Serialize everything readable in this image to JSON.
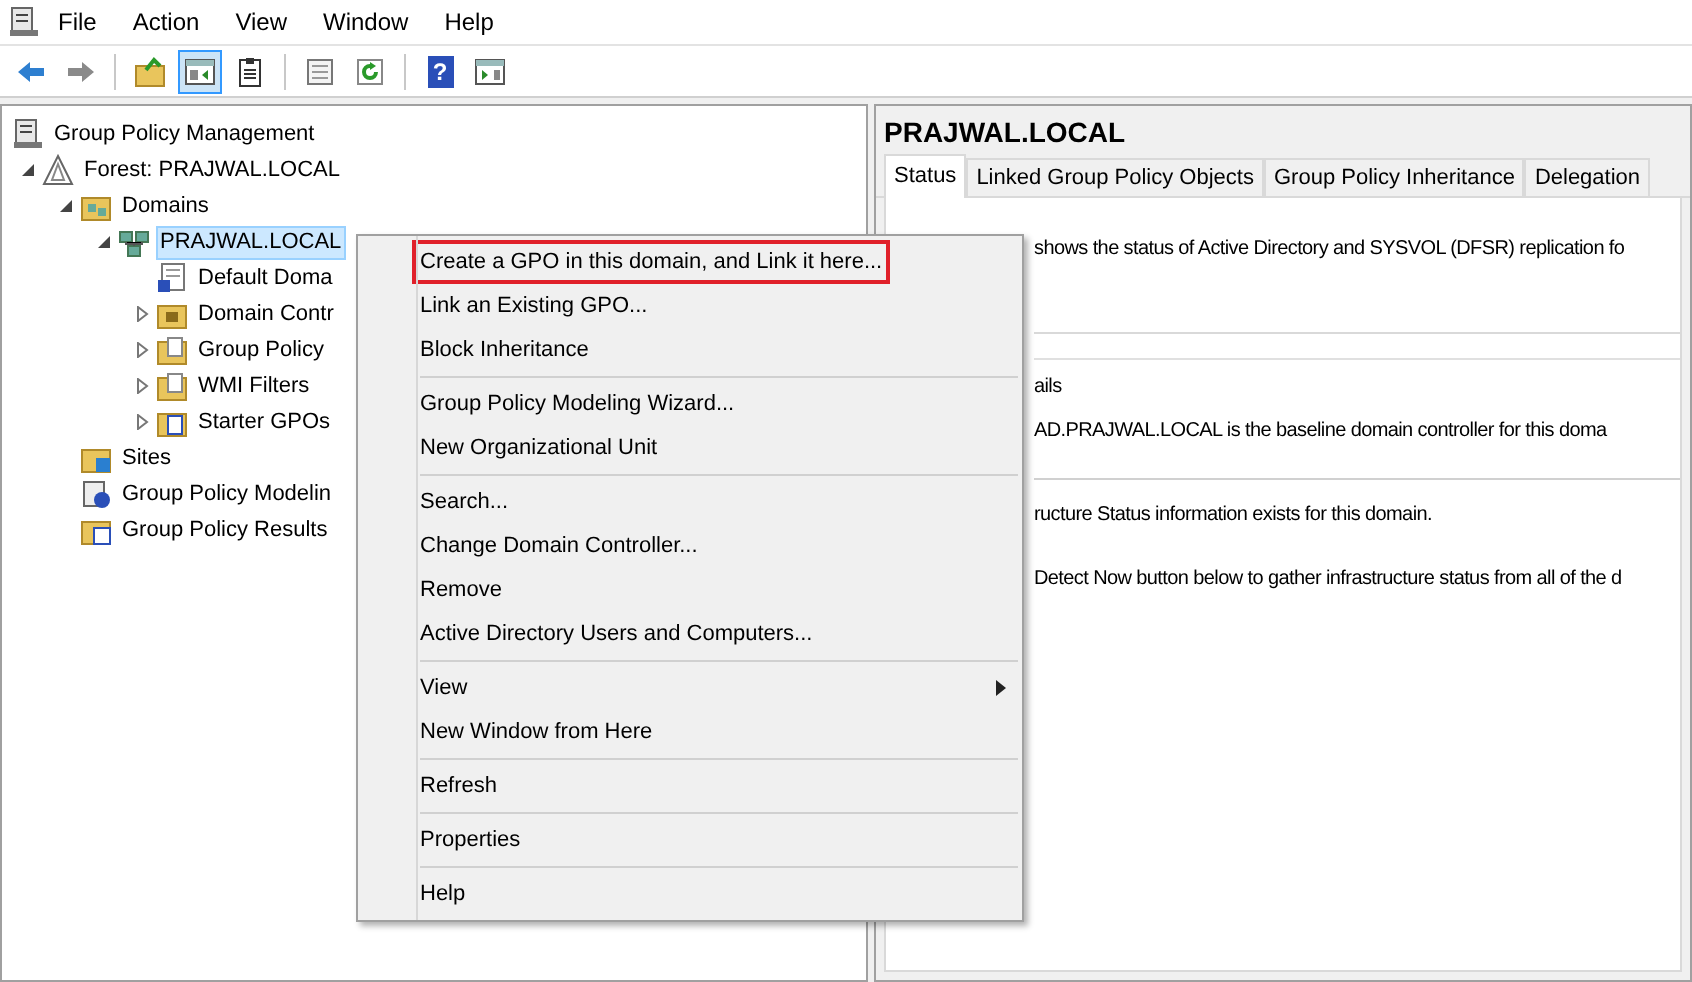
{
  "menu_bar": [
    "File",
    "Action",
    "View",
    "Window",
    "Help"
  ],
  "toolbar": [
    {
      "kind": "back",
      "pressed": false
    },
    {
      "kind": "forward",
      "pressed": false
    },
    {
      "kind": "separator"
    },
    {
      "kind": "folder",
      "pressed": false
    },
    {
      "kind": "tree",
      "pressed": true
    },
    {
      "kind": "clipboard",
      "pressed": false
    },
    {
      "kind": "separator"
    },
    {
      "kind": "list",
      "pressed": false
    },
    {
      "kind": "refresh",
      "pressed": false
    },
    {
      "kind": "separator"
    },
    {
      "kind": "help",
      "pressed": false,
      "glyph": "?"
    },
    {
      "kind": "pane",
      "pressed": false
    }
  ],
  "tree": [
    {
      "label": "Group Policy Management",
      "kind": "console",
      "selected": false,
      "children": [
        {
          "label": "Forest: PRAJWAL.LOCAL",
          "kind": "forest",
          "expanded": true,
          "selected": false,
          "children": [
            {
              "label": "Domains",
              "kind": "domains",
              "expanded": true,
              "selected": false,
              "children": [
                {
                  "label": "PRAJWAL.LOCAL",
                  "kind": "domain",
                  "expanded": true,
                  "selected": true,
                  "children": [
                    {
                      "label": "Default Doma",
                      "kind": "gpo",
                      "selected": false
                    },
                    {
                      "label": "Domain Contr",
                      "kind": "ou",
                      "expanded": false,
                      "selected": false
                    },
                    {
                      "label": "Group Policy",
                      "kind": "folder",
                      "expanded": false,
                      "selected": false
                    },
                    {
                      "label": "WMI Filters",
                      "kind": "folder",
                      "expanded": false,
                      "selected": false
                    },
                    {
                      "label": "Starter GPOs",
                      "kind": "starter",
                      "expanded": false,
                      "selected": false
                    }
                  ]
                }
              ]
            },
            {
              "label": "Sites",
              "kind": "sites",
              "selected": false
            },
            {
              "label": "Group Policy Modelin",
              "kind": "modeling",
              "selected": false
            },
            {
              "label": "Group Policy Results",
              "kind": "results",
              "selected": false
            }
          ]
        }
      ]
    }
  ],
  "details": {
    "title": "PRAJWAL.LOCAL",
    "tabs": [
      {
        "label": "Status",
        "selected": true
      },
      {
        "label": "Linked Group Policy Objects",
        "selected": false
      },
      {
        "label": "Group Policy Inheritance",
        "selected": false
      },
      {
        "label": "Delegation",
        "selected": false
      }
    ],
    "intro": "shows the status of Active Directory and SYSVOL (DFSR) replication fo",
    "section_heading": "ails",
    "baseline_note": "AD.PRAJWAL.LOCAL is the baseline domain controller for this doma",
    "status_note": "ructure Status information exists for this domain.",
    "detect_note": "Detect Now button below to gather infrastructure status from all of the d"
  },
  "context_menu": [
    [
      {
        "label": "Create a GPO in this domain, and Link it here...",
        "highlighted": true,
        "submenu": false
      },
      {
        "label": "Link an Existing GPO...",
        "highlighted": false,
        "submenu": false
      },
      {
        "label": "Block Inheritance",
        "highlighted": false,
        "submenu": false
      }
    ],
    [
      {
        "label": "Group Policy Modeling Wizard...",
        "highlighted": false,
        "submenu": false
      },
      {
        "label": "New Organizational Unit",
        "highlighted": false,
        "submenu": false
      }
    ],
    [
      {
        "label": "Search...",
        "highlighted": false,
        "submenu": false
      },
      {
        "label": "Change Domain Controller...",
        "highlighted": false,
        "submenu": false
      },
      {
        "label": "Remove",
        "highlighted": false,
        "submenu": false
      },
      {
        "label": "Active Directory Users and Computers...",
        "highlighted": false,
        "submenu": false
      }
    ],
    [
      {
        "label": "View",
        "highlighted": false,
        "submenu": true
      },
      {
        "label": "New Window from Here",
        "highlighted": false,
        "submenu": false
      }
    ],
    [
      {
        "label": "Refresh",
        "highlighted": false,
        "submenu": false
      }
    ],
    [
      {
        "label": "Properties",
        "highlighted": false,
        "submenu": false
      }
    ],
    [
      {
        "label": "Help",
        "highlighted": false,
        "submenu": false
      }
    ]
  ]
}
